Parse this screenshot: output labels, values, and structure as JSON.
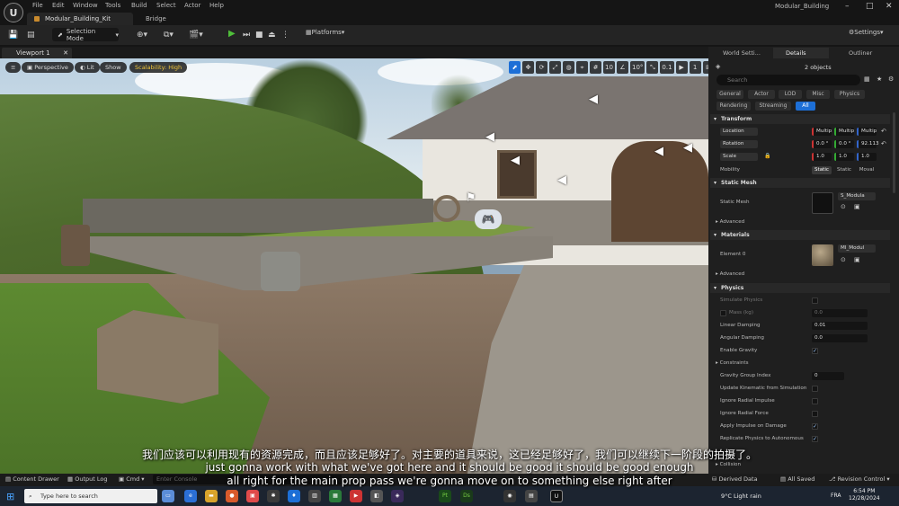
{
  "titlebar": {
    "logo": "U",
    "menu": [
      "File",
      "Edit",
      "Window",
      "Tools",
      "Build",
      "Select",
      "Actor",
      "Help"
    ],
    "project_tab": "Modular_Building_Kit",
    "bridge": "Bridge",
    "project_name": "Modular_Building",
    "window_controls": [
      "–",
      "□",
      "✕"
    ]
  },
  "toolbar": {
    "selection_mode": "Selection Mode",
    "platforms": "Platforms",
    "settings": "Settings"
  },
  "viewport": {
    "tab": "Viewport 1",
    "perspective": "Perspective",
    "lit": "Lit",
    "show": "Show",
    "scalability": "Scalability: High",
    "grid_snap": "10",
    "rot_snap": "10°",
    "scale_snap": "0.1",
    "camera_speed": "1"
  },
  "right_panel": {
    "tabs": [
      "World Setti...",
      "Details",
      "Outliner"
    ],
    "objects_count": "2 objects",
    "search_placeholder": "Search",
    "filters_row1": [
      "General",
      "Actor",
      "LOD",
      "Misc",
      "Physics"
    ],
    "filters_row2": [
      "Rendering",
      "Streaming",
      "All"
    ],
    "transform": {
      "header": "Transform",
      "location_label": "Location",
      "location_values": [
        "Multip",
        "Multip",
        "Multip"
      ],
      "rotation_label": "Rotation",
      "rotation_values": [
        "0.0 °",
        "0.0 °",
        "92.113"
      ],
      "scale_label": "Scale",
      "scale_values": [
        "1.0",
        "1.0",
        "1.0"
      ],
      "mobility_label": "Mobility",
      "mobility_options": [
        "Static",
        "Static",
        "Moval"
      ]
    },
    "static_mesh": {
      "header": "Static Mesh",
      "label": "Static Mesh",
      "value": "S_Modula",
      "advanced": "Advanced"
    },
    "materials": {
      "header": "Materials",
      "label": "Element 0",
      "value": "MI_Modul",
      "advanced": "Advanced"
    },
    "physics": {
      "header": "Physics",
      "simulate": "Simulate Physics",
      "mass": "Mass (kg)",
      "mass_value": "0.0",
      "linear_damping": "Linear Damping",
      "linear_damping_value": "0.01",
      "angular_damping": "Angular Damping",
      "angular_damping_value": "0.0",
      "enable_gravity": "Enable Gravity",
      "constraints": "Constraints",
      "gravity_group": "Gravity Group Index",
      "gravity_group_value": "0",
      "update_kinematic": "Update Kinematic from Simulation",
      "ignore_radial_impulse": "Ignore Radial Impulse",
      "ignore_radial_force": "Ignore Radial Force",
      "apply_impulse": "Apply Impulse on Damage",
      "replicate": "Replicate Physics to Autonomous",
      "collision": "Collision"
    }
  },
  "bottombar": {
    "content_drawer": "Content Drawer",
    "output_log": "Output Log",
    "cmd": "Cmd",
    "console_placeholder": "Enter Console",
    "derived_data": "Derived Data",
    "all_saved": "All Saved",
    "revision_control": "Revision Control"
  },
  "taskbar": {
    "search": "Type here to search",
    "weather": "9°C  Light rain",
    "lang": "FRA",
    "time": "6:54 PM",
    "date": "12/28/2024"
  },
  "subtitles": {
    "zh": "我们应该可以利用现有的资源完成，而且应该足够好了。对主要的道具来说，这已经足够好了，我们可以继续下一阶段的拍摄了。",
    "en1": "just gonna work with what we've got here and it should be good it should be good enough",
    "en2": "all right for the main prop pass we're gonna move on to something else right after"
  },
  "colors": {
    "accent": "#1d6fd6",
    "play": "#4fbf3a",
    "scalability": "#f0c53a"
  }
}
